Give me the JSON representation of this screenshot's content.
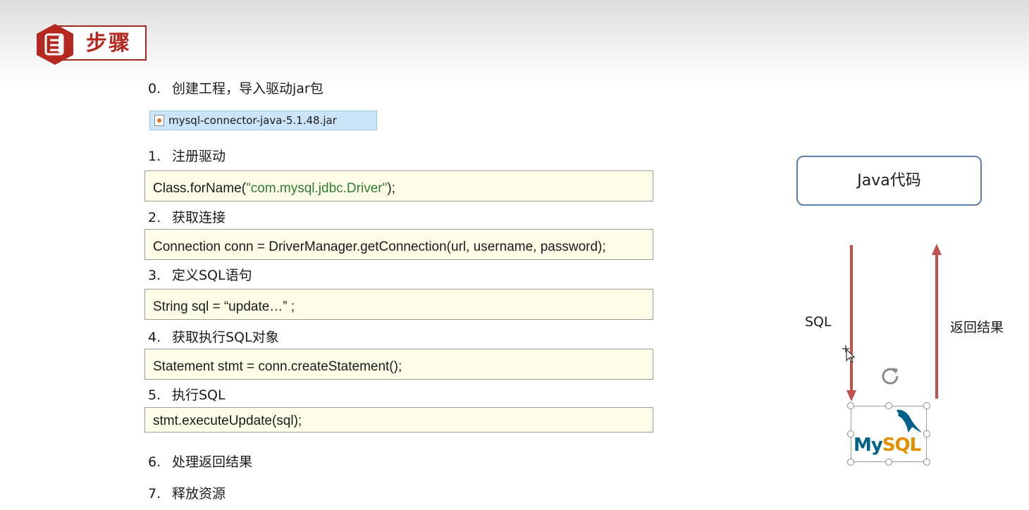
{
  "header": {
    "title": "步骤"
  },
  "steps": [
    {
      "num": "0.",
      "label": "创建工程，导入驱动jar包"
    },
    {
      "num": "1.",
      "label": "注册驱动"
    },
    {
      "num": "2.",
      "label": "获取连接"
    },
    {
      "num": "3.",
      "label": "定义SQL语句"
    },
    {
      "num": "4.",
      "label": "获取执行SQL对象"
    },
    {
      "num": "5.",
      "label": "执行SQL"
    },
    {
      "num": "6.",
      "label": "处理返回结果"
    },
    {
      "num": "7.",
      "label": "释放资源"
    }
  ],
  "jar_file": {
    "name": "mysql-connector-java-5.1.48.jar",
    "icon": "java-jar-icon"
  },
  "code": {
    "register": {
      "prefix": "Class.forName(",
      "string": "\"com.mysql.jdbc.Driver\"",
      "suffix": ");"
    },
    "connection": "Connection conn = DriverManager.getConnection(url, username, password);",
    "sql": "String sql = “update…” ;",
    "statement": "Statement stmt = conn.createStatement();",
    "execute": "stmt.executeUpdate(sql);"
  },
  "diagram": {
    "java_box": "Java代码",
    "sql_label": "SQL",
    "result_label": "返回结果",
    "logo": {
      "my": "My",
      "sql": "SQL"
    }
  },
  "colors": {
    "accent": "#b5281f",
    "arrow": "#c0504d",
    "java_border": "#5b7fa9",
    "code_bg": "#fefde8",
    "jar_highlight": "#cce4f7",
    "code_string": "#2e7d32"
  }
}
